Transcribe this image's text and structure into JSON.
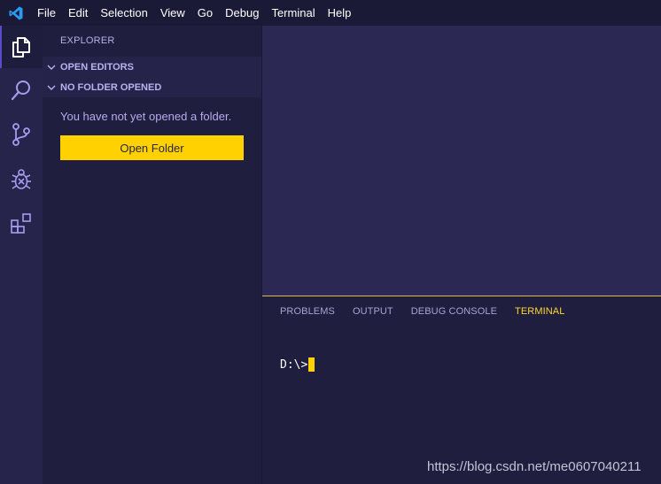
{
  "titlebar": {
    "menu": [
      "File",
      "Edit",
      "Selection",
      "View",
      "Go",
      "Debug",
      "Terminal",
      "Help"
    ]
  },
  "activity_bar": {
    "items": [
      {
        "icon": "files-icon",
        "active": true
      },
      {
        "icon": "search-icon",
        "active": false
      },
      {
        "icon": "source-control-icon",
        "active": false
      },
      {
        "icon": "debug-icon",
        "active": false
      },
      {
        "icon": "extensions-icon",
        "active": false
      }
    ]
  },
  "sidebar": {
    "title": "EXPLORER",
    "sections": [
      "OPEN EDITORS",
      "NO FOLDER OPENED"
    ],
    "empty_message": "You have not yet opened a folder.",
    "open_folder_label": "Open Folder"
  },
  "panel": {
    "tabs": [
      "PROBLEMS",
      "OUTPUT",
      "DEBUG CONSOLE",
      "TERMINAL"
    ],
    "active_tab": "TERMINAL",
    "terminal_prompt": "D:\\>"
  },
  "watermark": "https://blog.csdn.net/me0607040211",
  "colors": {
    "accent": "#ffd100",
    "activity_bar": "#26244a",
    "editor": "#2c2854",
    "panel": "#1f1e3e"
  }
}
